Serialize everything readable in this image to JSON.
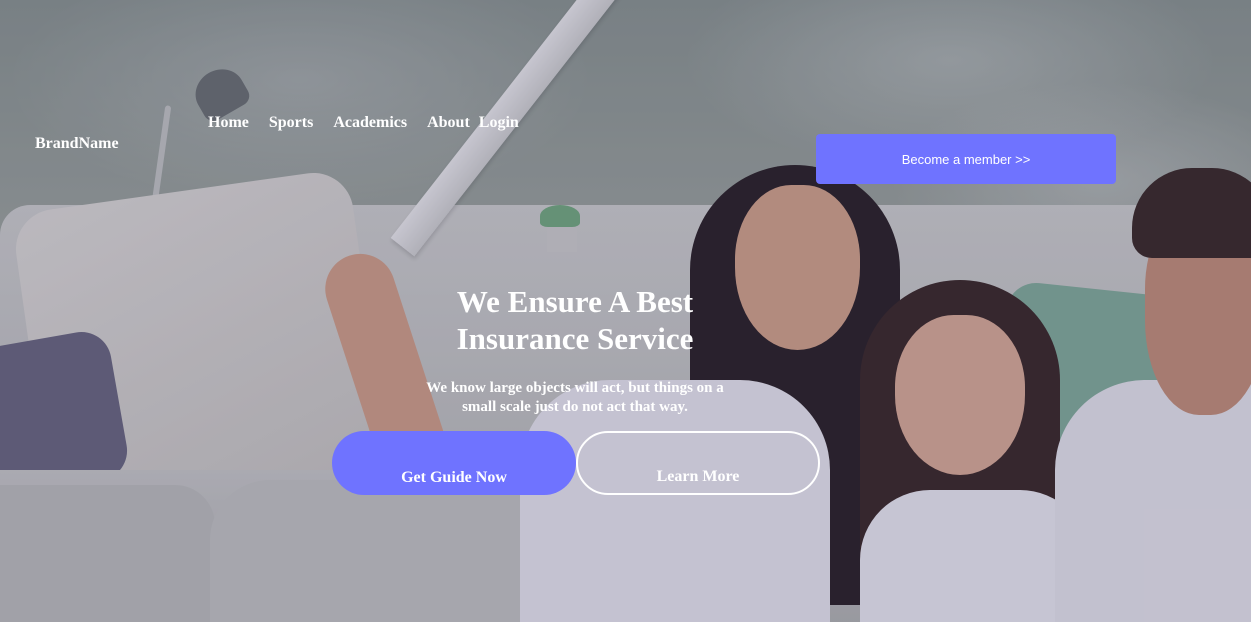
{
  "header": {
    "brand": "BrandName",
    "nav": {
      "home": "Home",
      "sports": "Sports",
      "academics": "Academics",
      "about": "About",
      "login": "Login"
    },
    "cta_label": "Become a member >>"
  },
  "hero": {
    "headline_line1": "We Ensure A Best",
    "headline_line2": "Insurance Service",
    "subtext_line1": "We know large objects will act, but things on a",
    "subtext_line2": "small scale just do not act that way.",
    "primary_button": "Get Guide Now",
    "secondary_button": "Learn More"
  },
  "colors": {
    "accent": "#6f73ff",
    "text": "#ffffff"
  }
}
